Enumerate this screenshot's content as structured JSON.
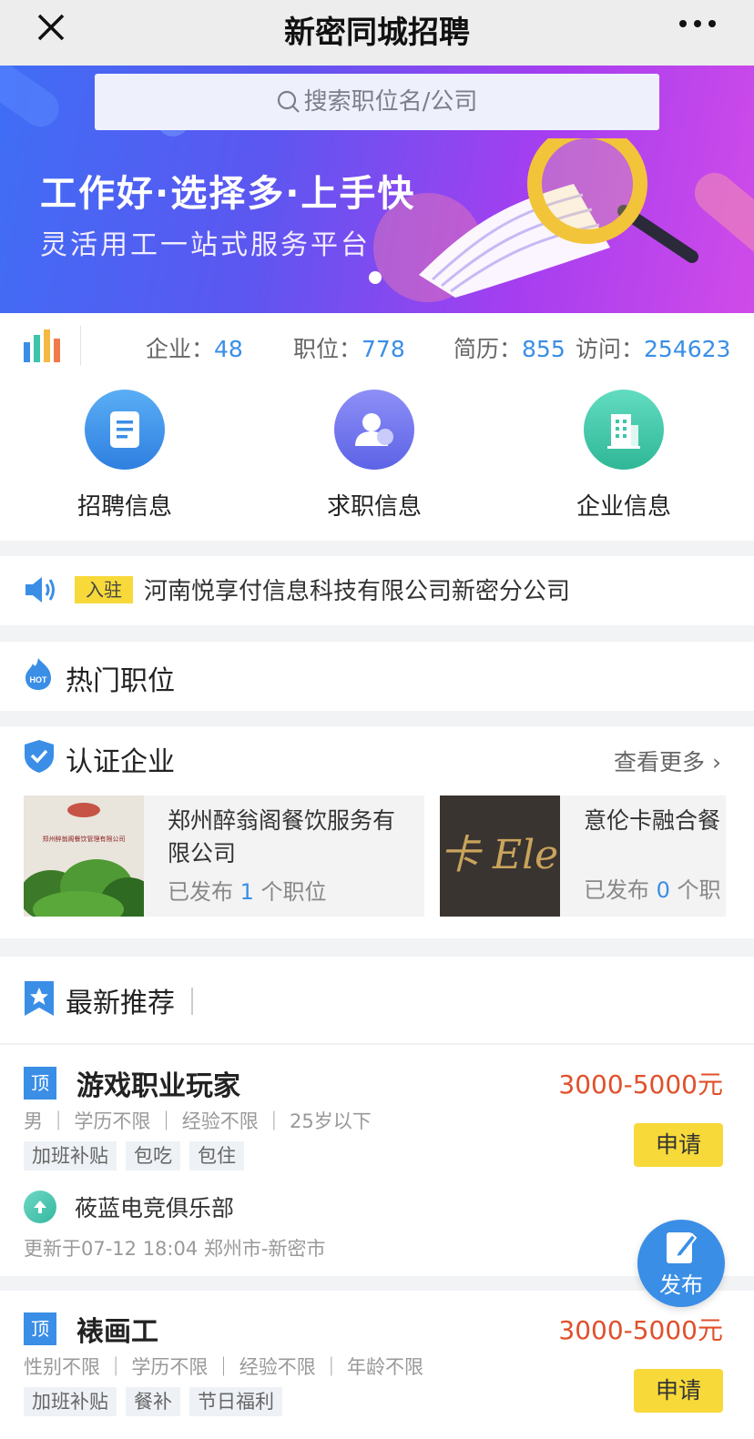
{
  "app": {
    "title": "新密同城招聘"
  },
  "banner": {
    "search_placeholder": "搜索职位名/公司",
    "slogan": "工作好·选择多·上手快",
    "subslogan": "灵活用工一站式服务平台"
  },
  "stats": {
    "companies_label": "企业：",
    "companies_value": "48",
    "jobs_label": "职位：",
    "jobs_value": "778",
    "resumes_label": "简历：",
    "resumes_value": "855",
    "visits_label": "访问：",
    "visits_value": "254623"
  },
  "menu": [
    {
      "label": "招聘信息",
      "color": "#3a8ee6"
    },
    {
      "label": "求职信息",
      "color": "#6a73ea"
    },
    {
      "label": "企业信息",
      "color": "#3cc5a8"
    }
  ],
  "notice": {
    "tag": "入驻",
    "text": "河南悦享付信息科技有限公司新密分公司"
  },
  "hot": {
    "title": "热门职位",
    "icon_text": "HOT"
  },
  "certified": {
    "title": "认证企业",
    "more": "查看更多",
    "cards": [
      {
        "name": "郑州醉翁阁餐饮服务有限公司",
        "posted_prefix": "已发布 ",
        "posted_count": "1",
        "posted_suffix": " 个职位",
        "logo_text": "郑州醉翁阁餐饮管理有限公司"
      },
      {
        "name": "意伦卡融合餐",
        "posted_prefix": "已发布 ",
        "posted_count": "0",
        "posted_suffix": " 个职",
        "logo_text": "卡 Ele"
      }
    ]
  },
  "latest": {
    "title": "最新推荐"
  },
  "jobs": [
    {
      "badge": "顶",
      "title": "游戏职业玩家",
      "salary": "3000-5000元",
      "meta": "男 ｜ 学历不限 ｜ 经验不限 ｜ 25岁以下",
      "tags": [
        "加班补贴",
        "包吃",
        "包住"
      ],
      "apply": "申请",
      "company": "莜蓝电竞俱乐部",
      "updated": "更新于07-12 18:04  郑州市-新密市"
    },
    {
      "badge": "顶",
      "title": "裱画工",
      "salary": "3000-5000元",
      "meta": "性别不限 ｜ 学历不限 ｜ 经验不限 ｜ 年龄不限",
      "tags": [
        "加班补贴",
        "餐补",
        "节日福利"
      ],
      "apply": "申请"
    }
  ],
  "fab": {
    "label": "发布"
  }
}
